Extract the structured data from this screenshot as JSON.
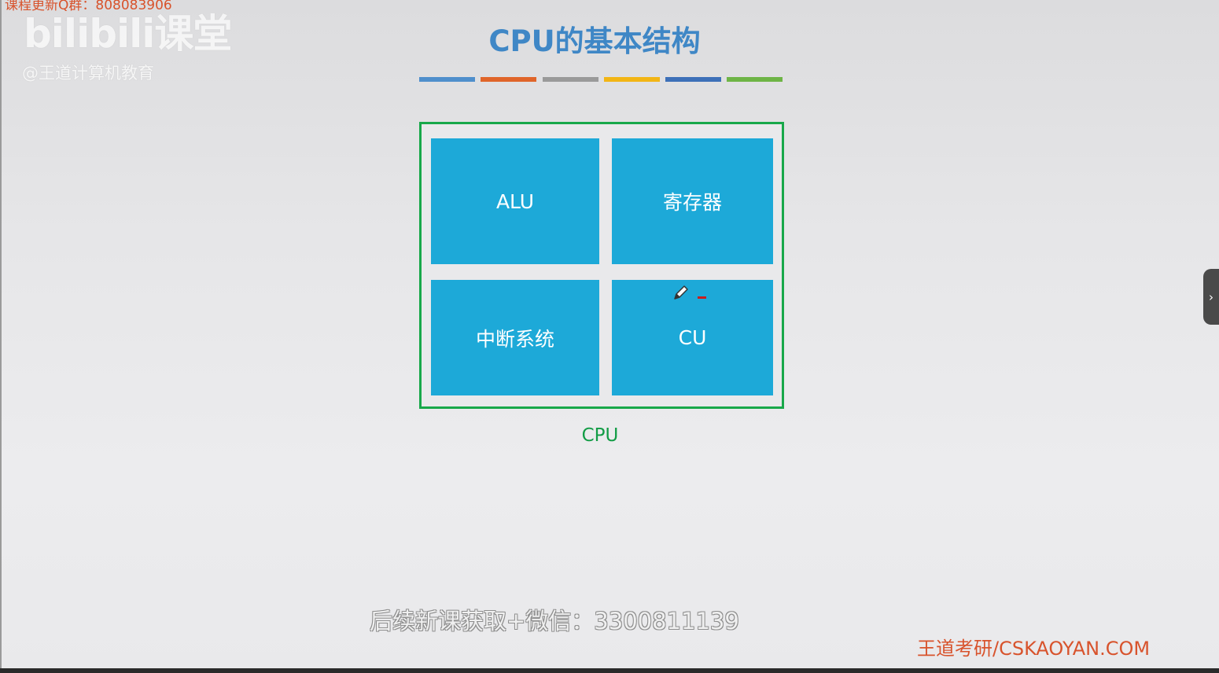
{
  "slide": {
    "title": "CPU的基本结构",
    "color_bars": [
      "#4f8fcc",
      "#e0652a",
      "#9a9a9a",
      "#f2b515",
      "#3d70b8",
      "#6eb446"
    ],
    "cpu_box": {
      "blocks": [
        {
          "label": "ALU"
        },
        {
          "label": "寄存器"
        },
        {
          "label": "中断系统"
        },
        {
          "label": "CU"
        }
      ],
      "caption": "CPU",
      "border_color": "#18a84a",
      "block_color": "#1da9d8"
    }
  },
  "watermarks": {
    "qq_group": "课程更新Q群：808083906",
    "bilibili_logo": "bilibili课堂",
    "bilibili_handle": "@王道计算机教育",
    "wechat": "后续新课获取+微信：3300811139",
    "site": "王道考研/CSKAOYAN.COM"
  },
  "annotation": {
    "tool": "pencil-icon",
    "mark_color": "#c81e1e"
  },
  "side_tab": {
    "icon": "chevron-right-icon",
    "glyph": "›"
  }
}
